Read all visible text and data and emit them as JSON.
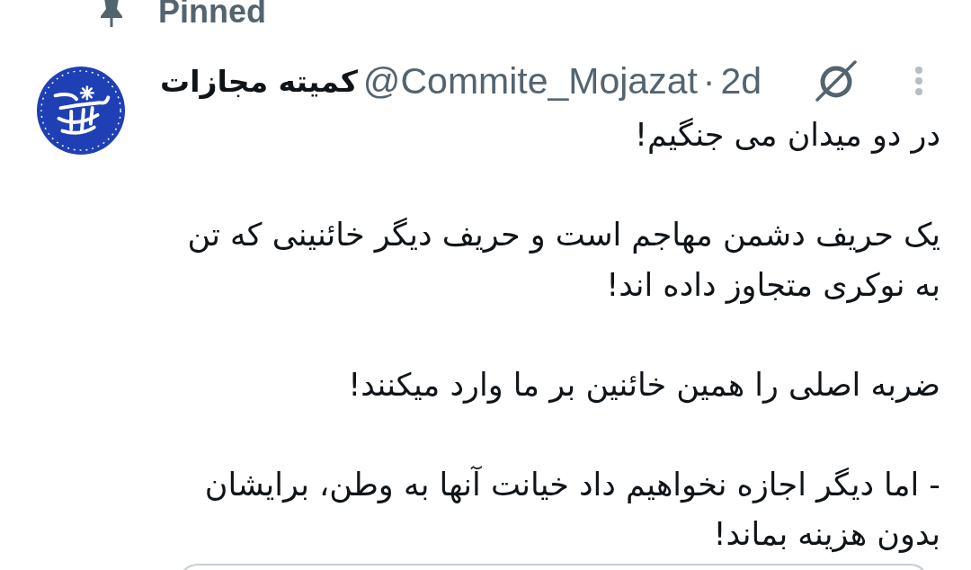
{
  "pinned": {
    "label": "Pinned"
  },
  "tweet": {
    "author": {
      "name": "کمیته مجازات",
      "handle": "@Commite_Mojazat"
    },
    "separator": "·",
    "time": "2d",
    "paragraphs": [
      "در دو میدان می جنگیم!",
      "یک حریف دشمن مهاجم است و حریف دیگر خائنینی که تن\nبه نوکری متجاوز داده اند!",
      "ضربه اصلی را همین خائنین بر ما وارد میکنند!",
      "- اما دیگر اجازه نخواهیم داد خیانت آنها به وطن، برایشان\nبدون هزینه بماند!"
    ]
  }
}
